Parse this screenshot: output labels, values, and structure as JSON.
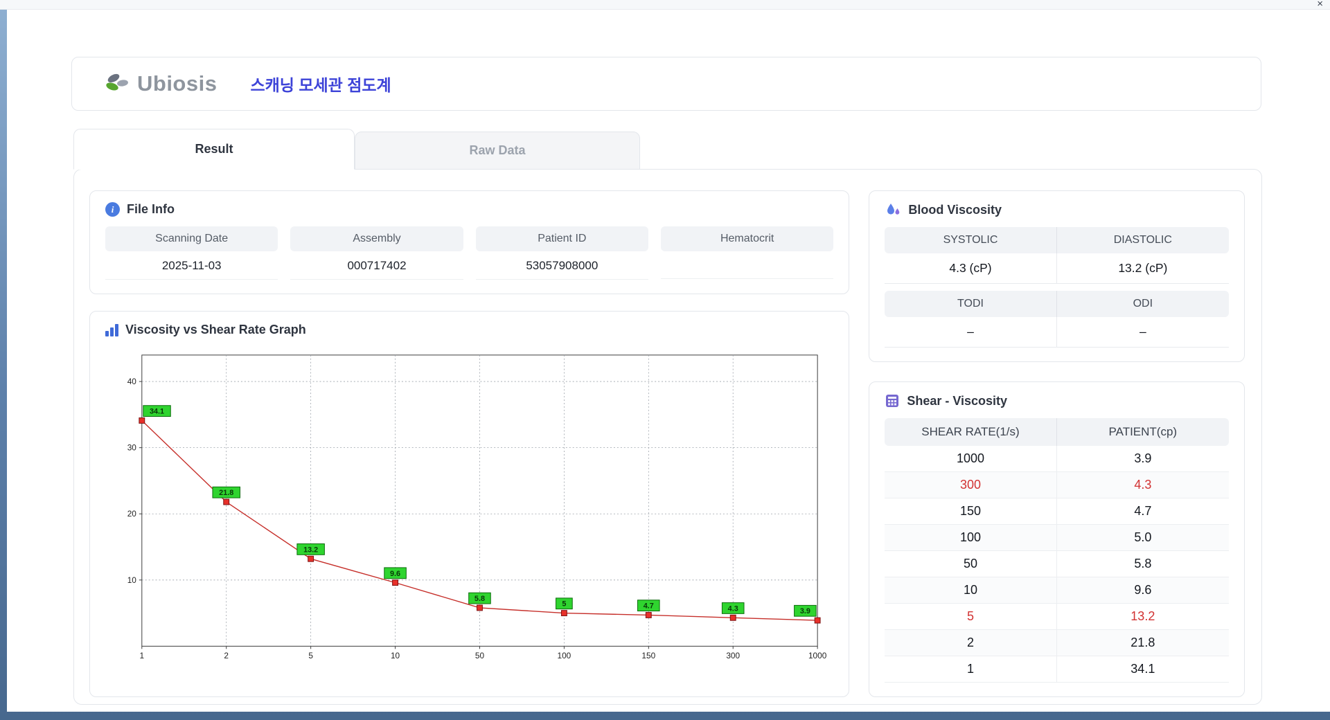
{
  "window": {
    "close_icon": "×"
  },
  "header": {
    "logo_text": "Ubiosis",
    "title": "스캐닝 모세관 점도계"
  },
  "tabs": {
    "result": "Result",
    "raw_data": "Raw Data"
  },
  "file_info": {
    "title": "File Info",
    "fields": [
      {
        "label": "Scanning Date",
        "value": "2025-11-03"
      },
      {
        "label": "Assembly",
        "value": "000717402"
      },
      {
        "label": "Patient ID",
        "value": "53057908000"
      },
      {
        "label": "Hematocrit",
        "value": ""
      }
    ]
  },
  "blood_viscosity": {
    "title": "Blood Viscosity",
    "rows": [
      {
        "labels": [
          "SYSTOLIC",
          "DIASTOLIC"
        ],
        "values": [
          "4.3 (cP)",
          "13.2 (cP)"
        ]
      },
      {
        "labels": [
          "TODI",
          "ODI"
        ],
        "values": [
          "–",
          "–"
        ]
      }
    ]
  },
  "graph": {
    "title": "Viscosity vs Shear Rate Graph"
  },
  "chart_data": {
    "type": "line",
    "title": "Viscosity vs Shear Rate Graph",
    "categories": [
      "1",
      "2",
      "5",
      "10",
      "50",
      "100",
      "150",
      "300",
      "1000"
    ],
    "values": [
      34.1,
      21.8,
      13.2,
      9.6,
      5.8,
      5,
      4.7,
      4.3,
      3.9
    ],
    "point_labels": [
      "34.1",
      "21.8",
      "13.2",
      "9.6",
      "5.8",
      "5",
      "4.7",
      "4.3",
      "3.9"
    ],
    "xlabel": "",
    "ylabel": "",
    "ylim": [
      0,
      44
    ],
    "yticks": [
      10,
      20,
      30,
      40
    ],
    "grid": true,
    "legend": false,
    "line_color": "#c62f2a",
    "marker_color": "#e8302a",
    "marker_stroke": "#7a1212",
    "label_bg": "#2fd42f",
    "label_stroke": "#0b6b0b"
  },
  "shear_table": {
    "title": "Shear - Viscosity",
    "columns": [
      "SHEAR RATE(1/s)",
      "PATIENT(cp)"
    ],
    "rows": [
      {
        "shear": "1000",
        "patient": "3.9",
        "highlight": false
      },
      {
        "shear": "300",
        "patient": "4.3",
        "highlight": true
      },
      {
        "shear": "150",
        "patient": "4.7",
        "highlight": false
      },
      {
        "shear": "100",
        "patient": "5.0",
        "highlight": false
      },
      {
        "shear": "50",
        "patient": "5.8",
        "highlight": false
      },
      {
        "shear": "10",
        "patient": "9.6",
        "highlight": false
      },
      {
        "shear": "5",
        "patient": "13.2",
        "highlight": true
      },
      {
        "shear": "2",
        "patient": "21.8",
        "highlight": false
      },
      {
        "shear": "1",
        "patient": "34.1",
        "highlight": false
      }
    ]
  }
}
